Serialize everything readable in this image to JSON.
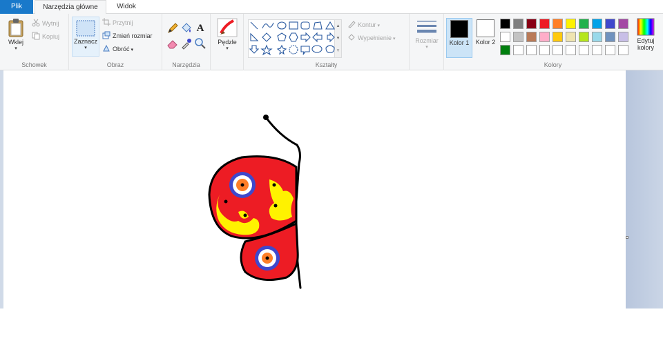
{
  "tabs": {
    "file": "Plik",
    "home": "Narzędzia główne",
    "view": "Widok"
  },
  "ribbon": {
    "clipboard": {
      "label": "Schowek",
      "paste": "Wklej",
      "cut": "Wytnij",
      "copy": "Kopiuj"
    },
    "image": {
      "label": "Obraz",
      "select": "Zaznacz",
      "crop": "Przytnij",
      "resize": "Zmień rozmiar",
      "rotate": "Obróć"
    },
    "tools": {
      "label": "Narzędzia"
    },
    "brushes": {
      "label": "Pędzle"
    },
    "shapes": {
      "label": "Kształty",
      "outline": "Kontur",
      "fill": "Wypełnienie"
    },
    "size": {
      "label": "Rozmiar"
    },
    "colors": {
      "label": "Kolory",
      "color1": "Kolor 1",
      "color2": "Kolor 2",
      "edit": "Edytuj kolory",
      "color1_value": "#000000",
      "color2_value": "#ffffff",
      "palette": [
        "#000000",
        "#7f7f7f",
        "#880015",
        "#ed1c24",
        "#ff7f27",
        "#fff200",
        "#22b14c",
        "#00a2e8",
        "#3f48cc",
        "#a349a4",
        "#ffffff",
        "#c3c3c3",
        "#b97a57",
        "#ffaec9",
        "#ffc90e",
        "#efe4b0",
        "#b5e61d",
        "#99d9ea",
        "#7092be",
        "#c8bfe7",
        "#007f0e",
        "#ffffff",
        "#ffffff",
        "#ffffff",
        "#ffffff",
        "#ffffff",
        "#ffffff",
        "#ffffff",
        "#ffffff",
        "#ffffff"
      ]
    }
  },
  "icons": {
    "paste": "clipboard-icon",
    "cut": "scissors-icon",
    "copy": "copy-icon",
    "select": "select-rectangle-icon",
    "crop": "crop-icon",
    "resize": "resize-icon",
    "rotate": "rotate-icon",
    "pencil": "pencil-icon",
    "fill": "bucket-icon",
    "text": "text-icon",
    "eraser": "eraser-icon",
    "picker": "color-picker-icon",
    "magnifier": "magnifier-icon",
    "brushes": "brush-icon",
    "size": "line-size-icon",
    "edit_colors": "color-spectrum-icon"
  },
  "drawing": {
    "subject": "butterfly",
    "colors": {
      "wing": "#ed1c24",
      "spot": "#fff200",
      "eye_outer": "#3f48cc",
      "eye_ring": "#ffffff",
      "eye_inner": "#ff7f27",
      "outline": "#000000"
    }
  }
}
